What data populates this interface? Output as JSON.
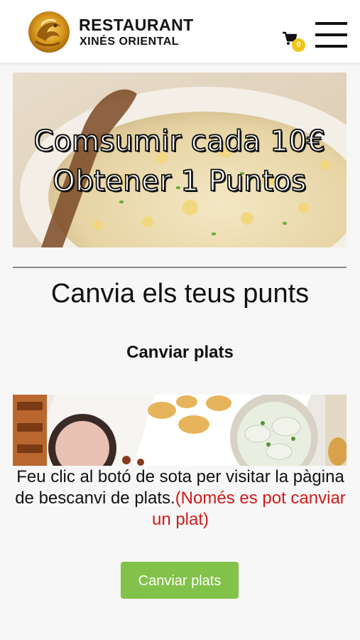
{
  "header": {
    "brand_line1": "RESTAURANT",
    "brand_line2": "XINÉS ORIENTAL",
    "cart_count": "0",
    "icons": {
      "logo": "dragon-logo",
      "cart": "cart-icon",
      "menu": "hamburger-menu-icon"
    }
  },
  "hero": {
    "line1": "Comsumir cada 10€",
    "line2": "Obtener 1 Puntos"
  },
  "main": {
    "title": "Canvia els teus punts",
    "subtitle": "Canviar plats",
    "info_text": "Feu clic al botó de sota per visitar la pàgina de bescanvi de plats.",
    "info_note": "(Només es pot canviar un plat)",
    "button_label": "Canviar plats"
  },
  "colors": {
    "accent_green": "#82c14a",
    "note_red": "#d11a1a",
    "badge_yellow": "#f2c417"
  }
}
